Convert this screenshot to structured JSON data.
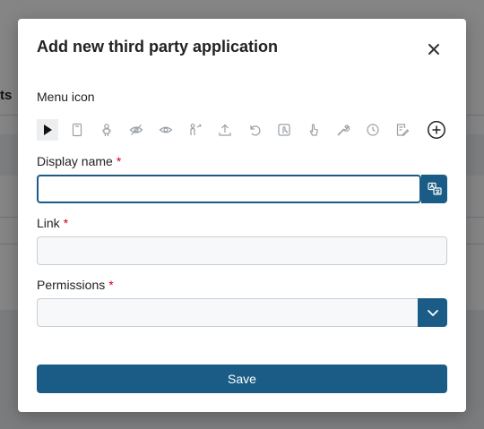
{
  "background": {
    "header_fragment": "ts"
  },
  "modal": {
    "title": "Add new third party application",
    "menu_icon_label": "Menu icon",
    "icon_options": [
      "play-icon",
      "file-icon",
      "robot-icon",
      "eye-off-icon",
      "eye-icon",
      "person-arrow-icon",
      "upload-icon",
      "undo-icon",
      "touch-screen-icon",
      "hand-pointer-icon",
      "wrench-icon",
      "clock-icon",
      "edit-document-icon",
      "add-circle-icon"
    ],
    "selected_icon": "play-icon",
    "display_name": {
      "label": "Display name",
      "required_mark": "*",
      "value": ""
    },
    "link": {
      "label": "Link",
      "required_mark": "*",
      "value": ""
    },
    "permissions": {
      "label": "Permissions",
      "required_mark": "*",
      "value": ""
    },
    "save_label": "Save"
  },
  "colors": {
    "primary": "#1a5c85",
    "required": "#d0021b"
  }
}
